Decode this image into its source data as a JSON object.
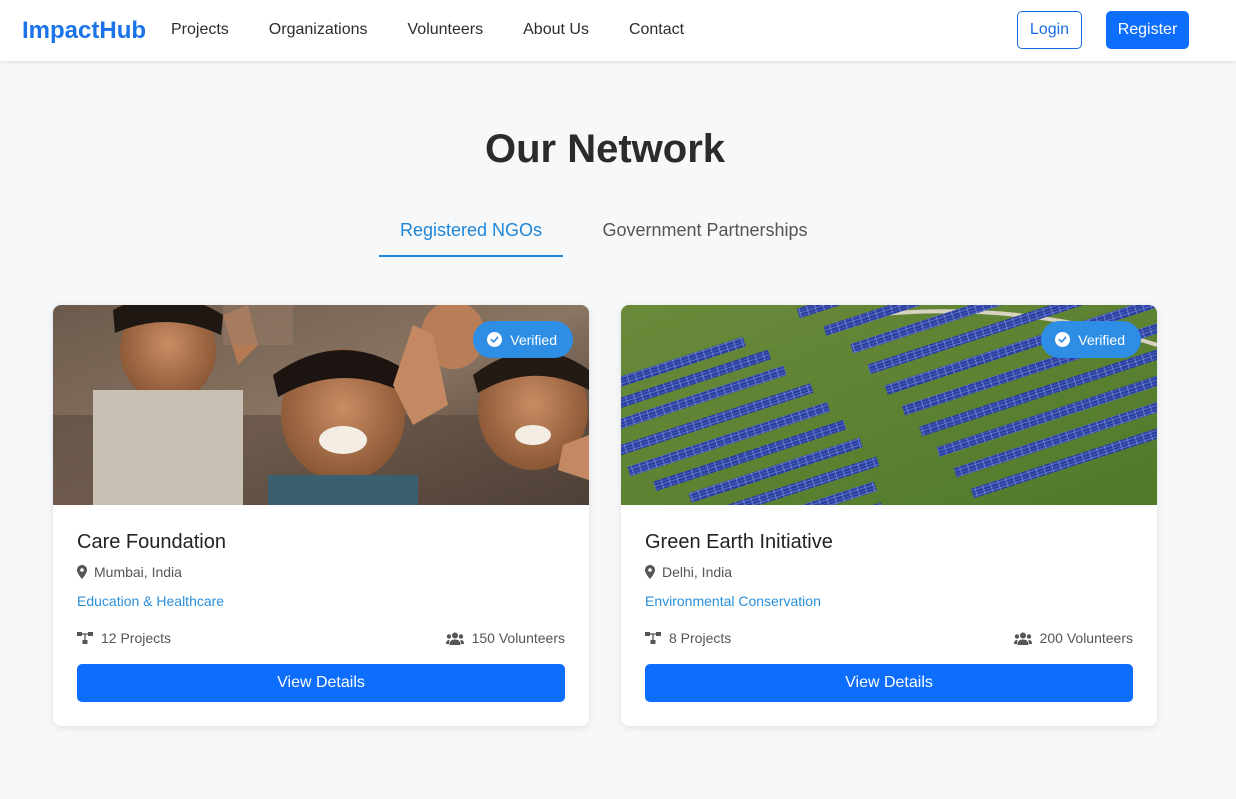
{
  "nav": {
    "brand": "ImpactHub",
    "links": [
      "Projects",
      "Organizations",
      "Volunteers",
      "About Us",
      "Contact"
    ],
    "login_label": "Login",
    "register_label": "Register"
  },
  "page": {
    "title": "Our Network"
  },
  "tabs": [
    {
      "label": "Registered NGOs",
      "active": true
    },
    {
      "label": "Government Partnerships",
      "active": false
    }
  ],
  "cards": [
    {
      "badge": "Verified",
      "title": "Care Foundation",
      "location": "Mumbai, India",
      "category": "Education & Healthcare",
      "projects": "12 Projects",
      "volunteers": "150 Volunteers",
      "button": "View Details",
      "image": "children-smiling-photo"
    },
    {
      "badge": "Verified",
      "title": "Green Earth Initiative",
      "location": "Delhi, India",
      "category": "Environmental Conservation",
      "projects": "8 Projects",
      "volunteers": "200 Volunteers",
      "button": "View Details",
      "image": "solar-farm-aerial-photo"
    }
  ],
  "colors": {
    "brand": "#1a73e8",
    "primary": "#0d6efd",
    "tab_active": "#1d86d8",
    "badge": "#2e8ee6",
    "background": "#f7f8fa"
  }
}
